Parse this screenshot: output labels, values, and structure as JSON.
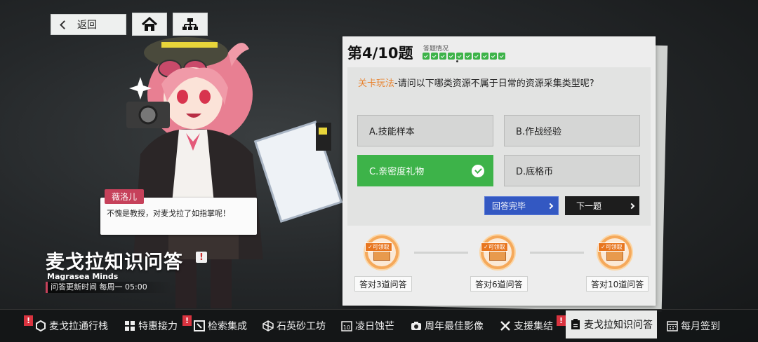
{
  "nav": {
    "back_label": "返回",
    "home_icon": "home-icon",
    "tree_icon": "sitemap-icon"
  },
  "dialog": {
    "speaker": "薇洛儿",
    "text": "不愧是教授，对麦戈拉了如指掌呢！"
  },
  "event": {
    "title": "麦戈拉知识问答",
    "title_badge": "!",
    "subtitle": "Magrasea Minds",
    "update_info": "问答更新时间 每周一 05:00"
  },
  "quiz": {
    "question_number": "第4/10题",
    "progress_label": "答题情况",
    "answered_count": 10,
    "question_tag": "关卡玩法",
    "question_text": "-请问以下哪类资源不属于日常的资源采集类型呢?",
    "options": [
      {
        "label": "A.技能样本",
        "correct": false
      },
      {
        "label": "B.作战经验",
        "correct": false
      },
      {
        "label": "C.亲密度礼物",
        "correct": true
      },
      {
        "label": "D.底格币",
        "correct": false
      }
    ],
    "done_label": "回答完毕",
    "next_label": "下一题"
  },
  "rewards": [
    {
      "tag": "✓可领取",
      "label": "答对3道问答"
    },
    {
      "tag": "✓可领取",
      "label": "答对6道问答"
    },
    {
      "tag": "✓可领取",
      "label": "答对10道问答"
    }
  ],
  "tabs": [
    {
      "label": "麦戈拉通行栈",
      "alert": "!"
    },
    {
      "label": "特惠接力"
    },
    {
      "label": "检索集成",
      "alert": "!"
    },
    {
      "label": "石英砂工坊"
    },
    {
      "label": "凌日蚀芒"
    },
    {
      "label": "周年最佳影像"
    },
    {
      "label": "支援集结"
    },
    {
      "label": "麦戈拉知识问答",
      "alert": "!"
    },
    {
      "label": "每月签到"
    }
  ],
  "colors": {
    "accent_green": "#3db349",
    "accent_blue": "#3358c2",
    "tag_orange": "#e8832f",
    "alert_red": "#d9333f",
    "name_pink": "#c6415a"
  }
}
